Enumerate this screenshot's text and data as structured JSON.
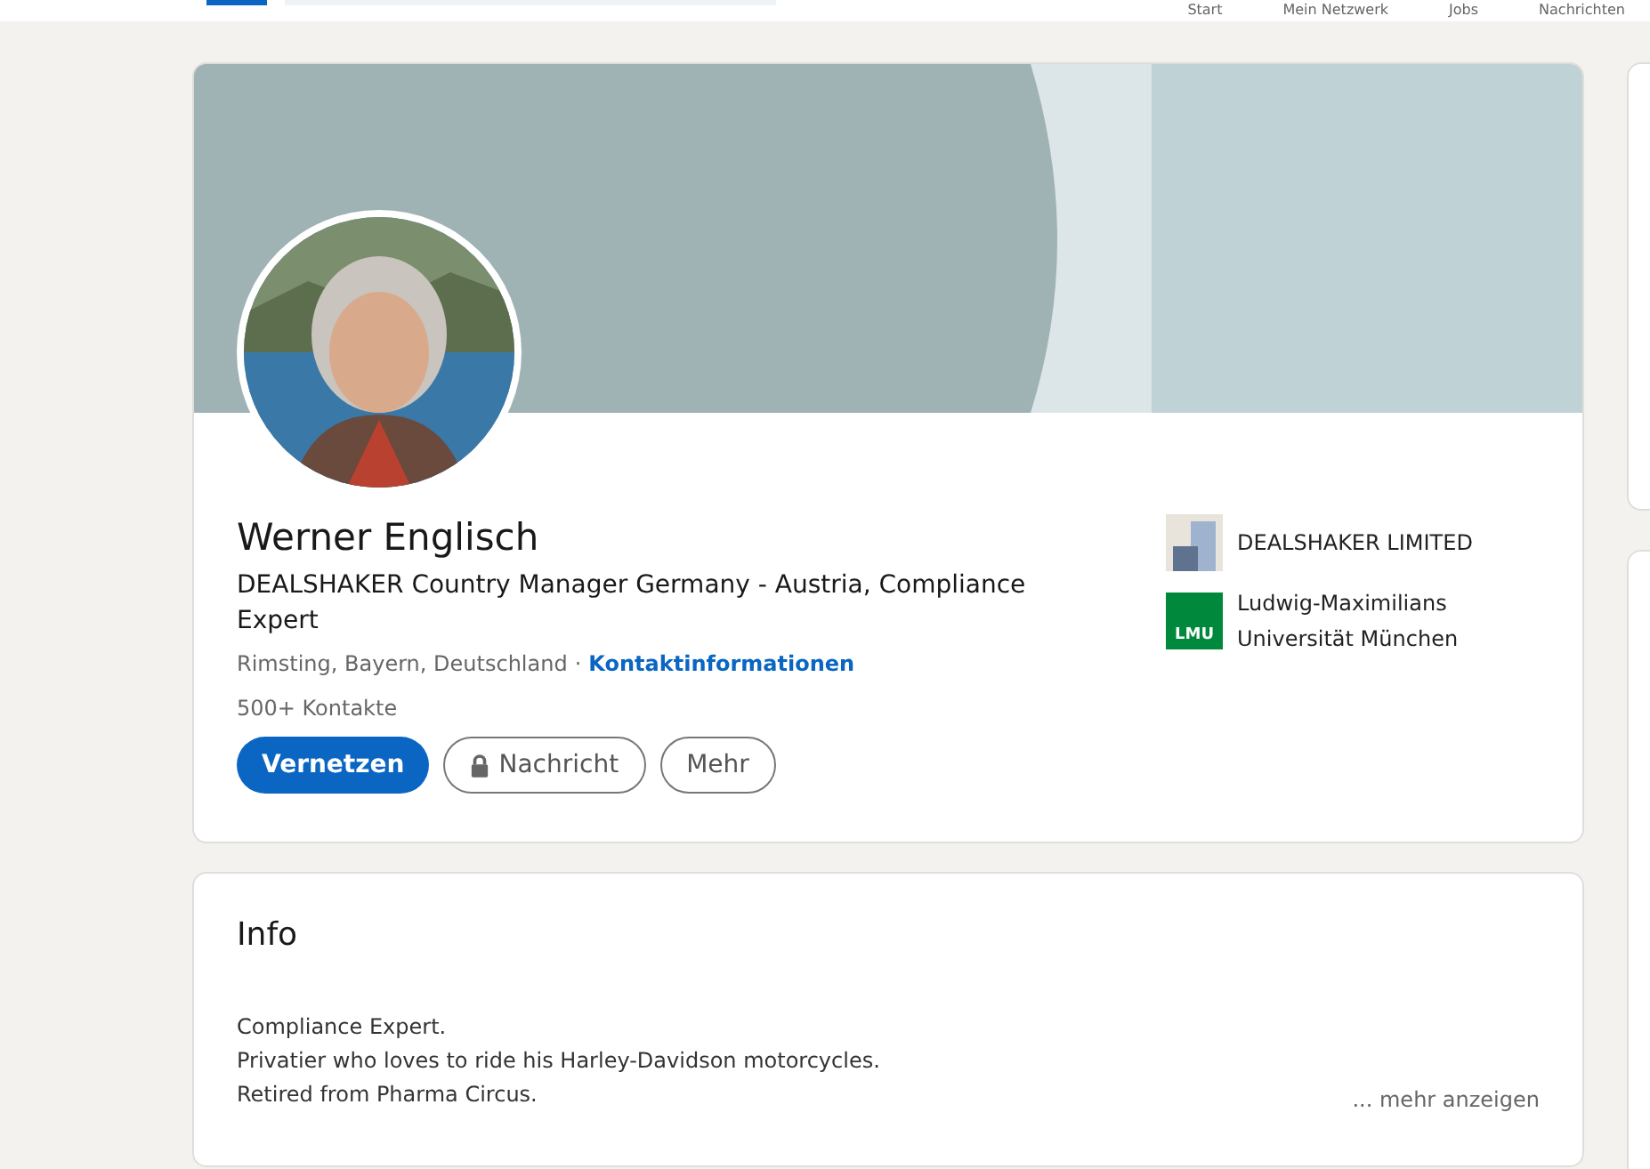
{
  "nav": {
    "items": [
      "Start",
      "Mein Netzwerk",
      "Jobs",
      "Nachrichten"
    ]
  },
  "profile": {
    "name": "Werner Englisch",
    "headline": "DEALSHAKER Country Manager Germany - Austria, Compliance Expert",
    "location": "Rimsting, Bayern, Deutschland",
    "separator": "·",
    "contact_link": "Kontaktinformationen",
    "connections": "500+ Kontakte",
    "buttons": [
      {
        "label": "Vernetzen",
        "kind": "primary"
      },
      {
        "label": "Nachricht",
        "kind": "locked"
      },
      {
        "label": "Mehr",
        "kind": "outline"
      }
    ],
    "affiliations": [
      {
        "name": "DEALSHAKER LIMITED",
        "kind": "company"
      },
      {
        "name": "Ludwig-Maximilians Universität München",
        "kind": "university",
        "logo_text": "LMU"
      }
    ]
  },
  "info": {
    "title": "Info",
    "lines": [
      "Compliance Expert.",
      "Privatier who loves to ride his Harley-Davidson motorcycles.",
      "Retired from Pharma Circus."
    ],
    "more_link": "... mehr anzeigen"
  }
}
